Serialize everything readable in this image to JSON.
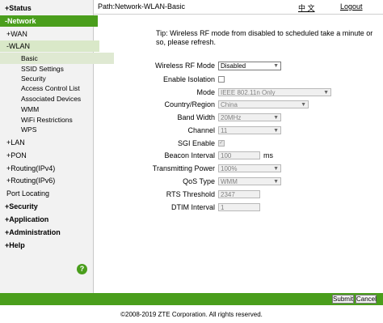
{
  "sidebar": {
    "items": [
      {
        "label": "+Status"
      },
      {
        "label": "-Network"
      },
      {
        "label": "+WAN"
      },
      {
        "label": "-WLAN"
      },
      {
        "label": "Basic"
      },
      {
        "label": "SSID Settings"
      },
      {
        "label": "Security"
      },
      {
        "label": "Access Control List"
      },
      {
        "label": "Associated Devices"
      },
      {
        "label": "WMM"
      },
      {
        "label": "WiFi Restrictions"
      },
      {
        "label": "WPS"
      },
      {
        "label": "+LAN"
      },
      {
        "label": "+PON"
      },
      {
        "label": "+Routing(IPv4)"
      },
      {
        "label": "+Routing(IPv6)"
      },
      {
        "label": "Port Locating"
      },
      {
        "label": "+Security"
      },
      {
        "label": "+Application"
      },
      {
        "label": "+Administration"
      },
      {
        "label": "+Help"
      }
    ],
    "help_glyph": "?"
  },
  "header": {
    "path": "Path:Network-WLAN-Basic",
    "lang": "中 文",
    "logout": "Logout"
  },
  "tip": "Tip: Wireless RF mode from disabled to scheduled take a minute or so, please refresh.",
  "form": {
    "rf_mode": {
      "label": "Wireless RF Mode",
      "value": "Disabled"
    },
    "isolation": {
      "label": "Enable Isolation",
      "checked": false
    },
    "mode": {
      "label": "Mode",
      "value": "IEEE 802.11n Only"
    },
    "country": {
      "label": "Country/Region",
      "value": "China"
    },
    "bandwidth": {
      "label": "Band Width",
      "value": "20MHz"
    },
    "channel": {
      "label": "Channel",
      "value": "11"
    },
    "sgi": {
      "label": "SGI Enable",
      "checked": true
    },
    "beacon": {
      "label": "Beacon Interval",
      "value": "100",
      "unit": "ms"
    },
    "tx_power": {
      "label": "Transmitting Power",
      "value": "100%"
    },
    "qos": {
      "label": "QoS Type",
      "value": "WMM"
    },
    "rts": {
      "label": "RTS Threshold",
      "value": "2347"
    },
    "dtim": {
      "label": "DTIM Interval",
      "value": "1"
    }
  },
  "buttons": {
    "submit": "Submit",
    "cancel": "Cancel"
  },
  "copyright": "©2008-2019 ZTE Corporation. All rights reserved.",
  "colors": {
    "accent": "#4a9e1c"
  }
}
